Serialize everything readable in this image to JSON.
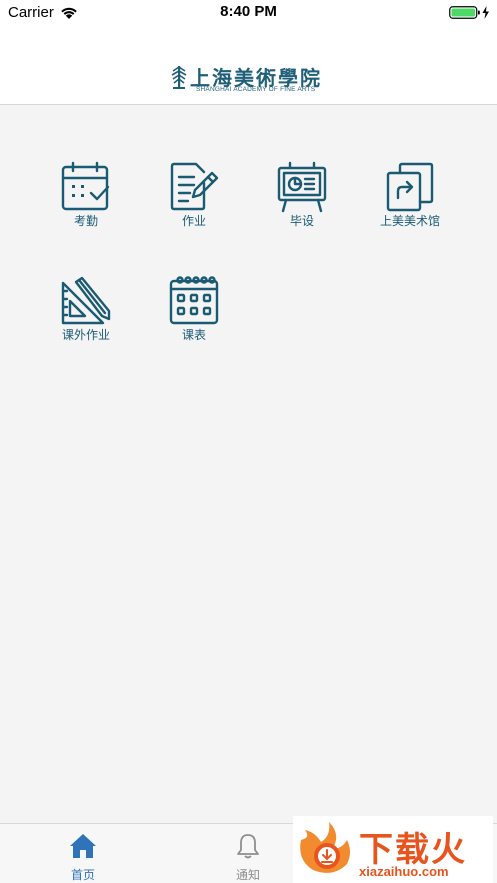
{
  "status_bar": {
    "carrier": "Carrier",
    "time": "8:40 PM"
  },
  "header": {
    "logo_cn": "上海美術學院",
    "logo_en": "SHANGHAI ACADEMY OF FINE ARTS"
  },
  "grid": [
    {
      "label": "考勤",
      "icon": "attendance-calendar-check-icon"
    },
    {
      "label": "作业",
      "icon": "homework-document-pencil-icon"
    },
    {
      "label": "毕设",
      "icon": "graduation-project-easel-icon"
    },
    {
      "label": "上美美术馆",
      "icon": "art-museum-share-icon"
    },
    {
      "label": "课外作业",
      "icon": "extracurricular-ruler-pencil-icon"
    },
    {
      "label": "课表",
      "icon": "timetable-calendar-icon"
    }
  ],
  "tabs": [
    {
      "label": "首页",
      "icon": "home-icon",
      "active": true
    },
    {
      "label": "通知",
      "icon": "bell-icon",
      "active": false
    }
  ],
  "watermark": {
    "text": "下载火",
    "url": "xiazaihuo.com"
  },
  "colors": {
    "accent": "#2f73b8",
    "icon": "#1b5a73",
    "inactive": "#8e8e8e",
    "watermark": "#e8541e"
  }
}
